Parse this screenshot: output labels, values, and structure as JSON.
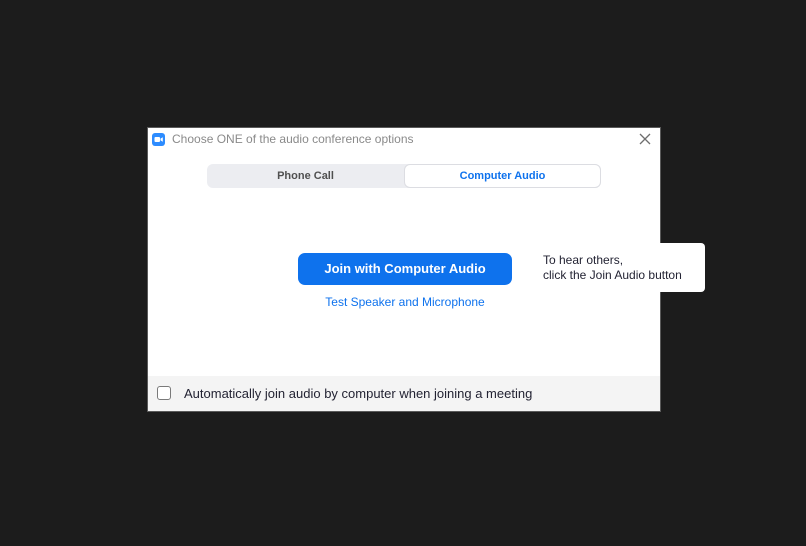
{
  "window": {
    "title": "Choose ONE of the audio conference options",
    "app_icon": "zoom-camera-icon",
    "close_icon": "close-icon"
  },
  "tabs": [
    {
      "label": "Phone Call",
      "selected": false
    },
    {
      "label": "Computer Audio",
      "selected": true
    }
  ],
  "main": {
    "join_button_label": "Join with Computer Audio",
    "test_link_label": "Test Speaker and Microphone"
  },
  "tooltip": {
    "line1": "To hear others,",
    "line2": "click the Join Audio button"
  },
  "footer": {
    "auto_join_label": "Automatically join audio by computer when joining a meeting",
    "auto_join_checked": false
  },
  "colors": {
    "accent": "#0e72ed",
    "logo": "#2d8cff",
    "background": "#1c1c1c"
  }
}
